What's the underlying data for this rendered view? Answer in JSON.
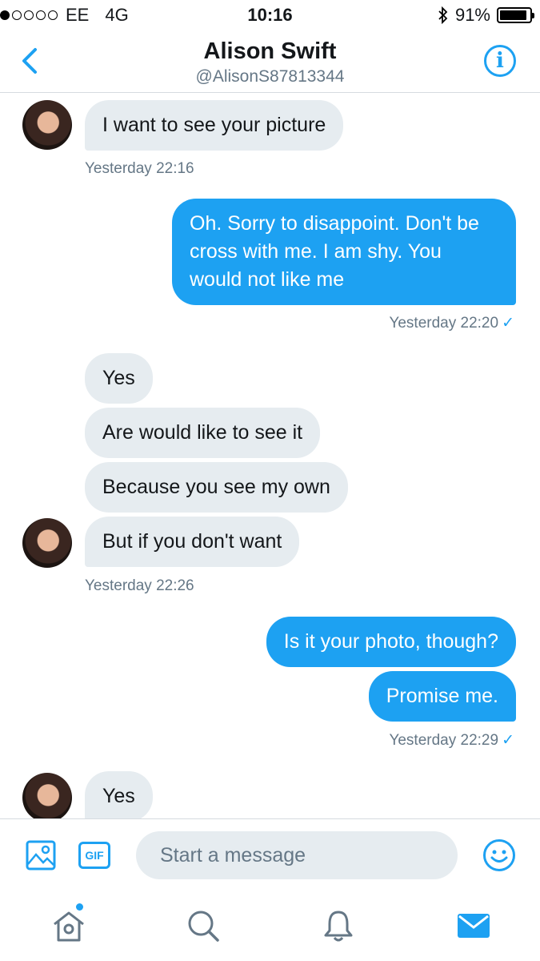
{
  "status_bar": {
    "carrier": "EE",
    "network": "4G",
    "time": "10:16",
    "battery": "91%",
    "battery_level": 0.91,
    "signal_strength": 1
  },
  "header": {
    "name": "Alison Swift",
    "handle": "@AlisonS87813344"
  },
  "messages": [
    {
      "text": "I want to see your picture",
      "direction": "in"
    },
    {
      "timestamp": "Yesterday 22:16"
    },
    {
      "text": "Oh. Sorry to disappoint. Don't be cross with me. I am shy. You would not like me",
      "direction": "out"
    },
    {
      "timestamp": "Yesterday 22:20",
      "read": "✓"
    },
    {
      "text": "Yes",
      "direction": "in"
    },
    {
      "text": "Are would like to see it",
      "direction": "in"
    },
    {
      "text": "Because you see my own",
      "direction": "in"
    },
    {
      "text": "But if you don't want",
      "direction": "in"
    },
    {
      "timestamp": "Yesterday 22:26"
    },
    {
      "text": "Is it your photo, though?",
      "direction": "out"
    },
    {
      "text": "Promise me.",
      "direction": "out"
    },
    {
      "timestamp": "Yesterday 22:29",
      "read": "✓"
    },
    {
      "text": "Yes",
      "direction": "in"
    }
  ],
  "composer": {
    "gif_label": "GIF",
    "placeholder": "Start a message"
  },
  "colors": {
    "accent": "#1da1f2",
    "incoming_bubble": "#e6ecf0",
    "secondary_text": "#657786"
  },
  "tabs": [
    "home-icon",
    "search-icon",
    "bell-icon",
    "mail-icon"
  ]
}
